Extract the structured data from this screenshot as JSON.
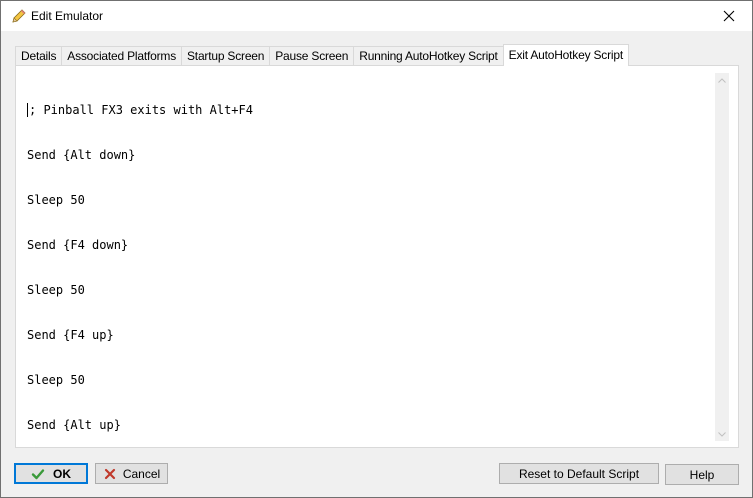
{
  "window": {
    "title": "Edit Emulator",
    "icon": "pencil-icon",
    "close_icon": "close-icon"
  },
  "tabs": [
    {
      "label": "Details",
      "active": false
    },
    {
      "label": "Associated Platforms",
      "active": false
    },
    {
      "label": "Startup Screen",
      "active": false
    },
    {
      "label": "Pause Screen",
      "active": false
    },
    {
      "label": "Running AutoHotkey Script",
      "active": false
    },
    {
      "label": "Exit AutoHotkey Script",
      "active": true
    }
  ],
  "script": {
    "lines": [
      "; Pinball FX3 exits with Alt+F4",
      "Send {Alt down}",
      "Sleep 50",
      "Send {F4 down}",
      "Sleep 50",
      "Send {F4 up}",
      "Sleep 50",
      "Send {Alt up}"
    ]
  },
  "buttons": {
    "ok_label": "OK",
    "cancel_label": "Cancel",
    "reset_label": "Reset to Default Script",
    "help_label": "Help"
  },
  "colors": {
    "accent": "#0078d7",
    "ok_check": "#3a9a3a",
    "cancel_x": "#c0392b"
  }
}
